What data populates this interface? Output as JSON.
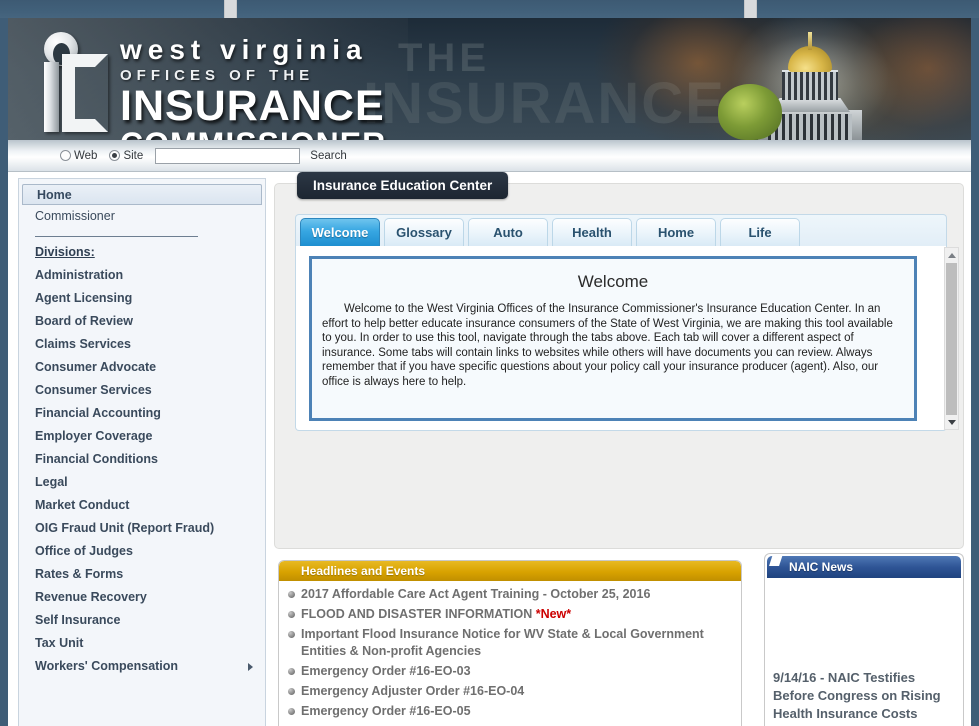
{
  "site": {
    "banner": {
      "line1": "west virginia",
      "line2": "OFFICES OF THE",
      "line3": "INSURANCE",
      "line4": "COMMISSIONER",
      "ghost_text": "THE",
      "ghost_text2": "INSURANCE"
    },
    "search": {
      "web_label": "Web",
      "site_label": "Site",
      "selected_scope": "Site",
      "input_value": "",
      "input_placeholder": "",
      "button_label": "Search"
    }
  },
  "sidebar": {
    "home_label": "Home",
    "commissioner_label": "Commissioner",
    "divisions_heading": "Divisions:",
    "divisions": [
      {
        "label": "Administration",
        "has_submenu": false
      },
      {
        "label": "Agent Licensing",
        "has_submenu": false
      },
      {
        "label": "Board of Review",
        "has_submenu": false
      },
      {
        "label": "Claims Services",
        "has_submenu": false
      },
      {
        "label": "Consumer Advocate",
        "has_submenu": false
      },
      {
        "label": "Consumer Services",
        "has_submenu": false
      },
      {
        "label": "Financial Accounting",
        "has_submenu": false
      },
      {
        "label": "Employer Coverage",
        "has_submenu": false
      },
      {
        "label": "Financial Conditions",
        "has_submenu": false
      },
      {
        "label": "Legal",
        "has_submenu": false
      },
      {
        "label": "Market Conduct",
        "has_submenu": false
      },
      {
        "label": "OIG Fraud Unit (Report Fraud)",
        "has_submenu": false
      },
      {
        "label": "Office of Judges",
        "has_submenu": false
      },
      {
        "label": "Rates & Forms",
        "has_submenu": false
      },
      {
        "label": "Revenue Recovery",
        "has_submenu": false
      },
      {
        "label": "Self Insurance",
        "has_submenu": false
      },
      {
        "label": "Tax Unit",
        "has_submenu": false
      },
      {
        "label": "Workers' Compensation",
        "has_submenu": true
      }
    ]
  },
  "education_center": {
    "title": "Insurance Education Center",
    "tabs": [
      {
        "label": "Welcome",
        "active": true
      },
      {
        "label": "Glossary",
        "active": false
      },
      {
        "label": "Auto",
        "active": false
      },
      {
        "label": "Health",
        "active": false
      },
      {
        "label": "Home",
        "active": false
      },
      {
        "label": "Life",
        "active": false
      }
    ],
    "panel": {
      "heading": "Welcome",
      "body": "Welcome to the West Virginia Offices of the Insurance Commissioner's Insurance Education Center. In an effort to help better educate insurance consumers of the State of West Virginia, we are making this tool available to you. In order to use this tool, navigate through the tabs above. Each tab will cover a different aspect of insurance. Some tabs will contain links to websites while others will have documents you can review. Always remember that if you have specific questions about your policy call your insurance producer (agent). Also, our office is always here to help."
    }
  },
  "headlines": {
    "title": "Headlines and Events",
    "items": [
      {
        "text": "2017 Affordable Care Act Agent Training - October 25, 2016",
        "badge": ""
      },
      {
        "text": "FLOOD AND DISASTER INFORMATION ",
        "badge": "*New*"
      },
      {
        "text": "Important Flood Insurance Notice for WV State & Local Government Entities & Non-profit Agencies",
        "badge": ""
      },
      {
        "text": "Emergency Order #16-EO-03",
        "badge": ""
      },
      {
        "text": "Emergency Adjuster Order #16-EO-04",
        "badge": ""
      },
      {
        "text": "Emergency Order #16-EO-05",
        "badge": ""
      }
    ]
  },
  "naic_news": {
    "title": "NAIC News",
    "items": [
      {
        "text": "9/14/16 - NAIC Testifies Before Congress on Rising Health Insurance Costs"
      }
    ]
  },
  "colors": {
    "frame_blue": "#3f5d77",
    "tab_active_blue": "#1e8fd0",
    "headlines_gold": "#d8a200",
    "naic_blue": "#2f5596",
    "new_badge_red": "#cc0000",
    "panel_border_blue": "#4d82b6"
  }
}
